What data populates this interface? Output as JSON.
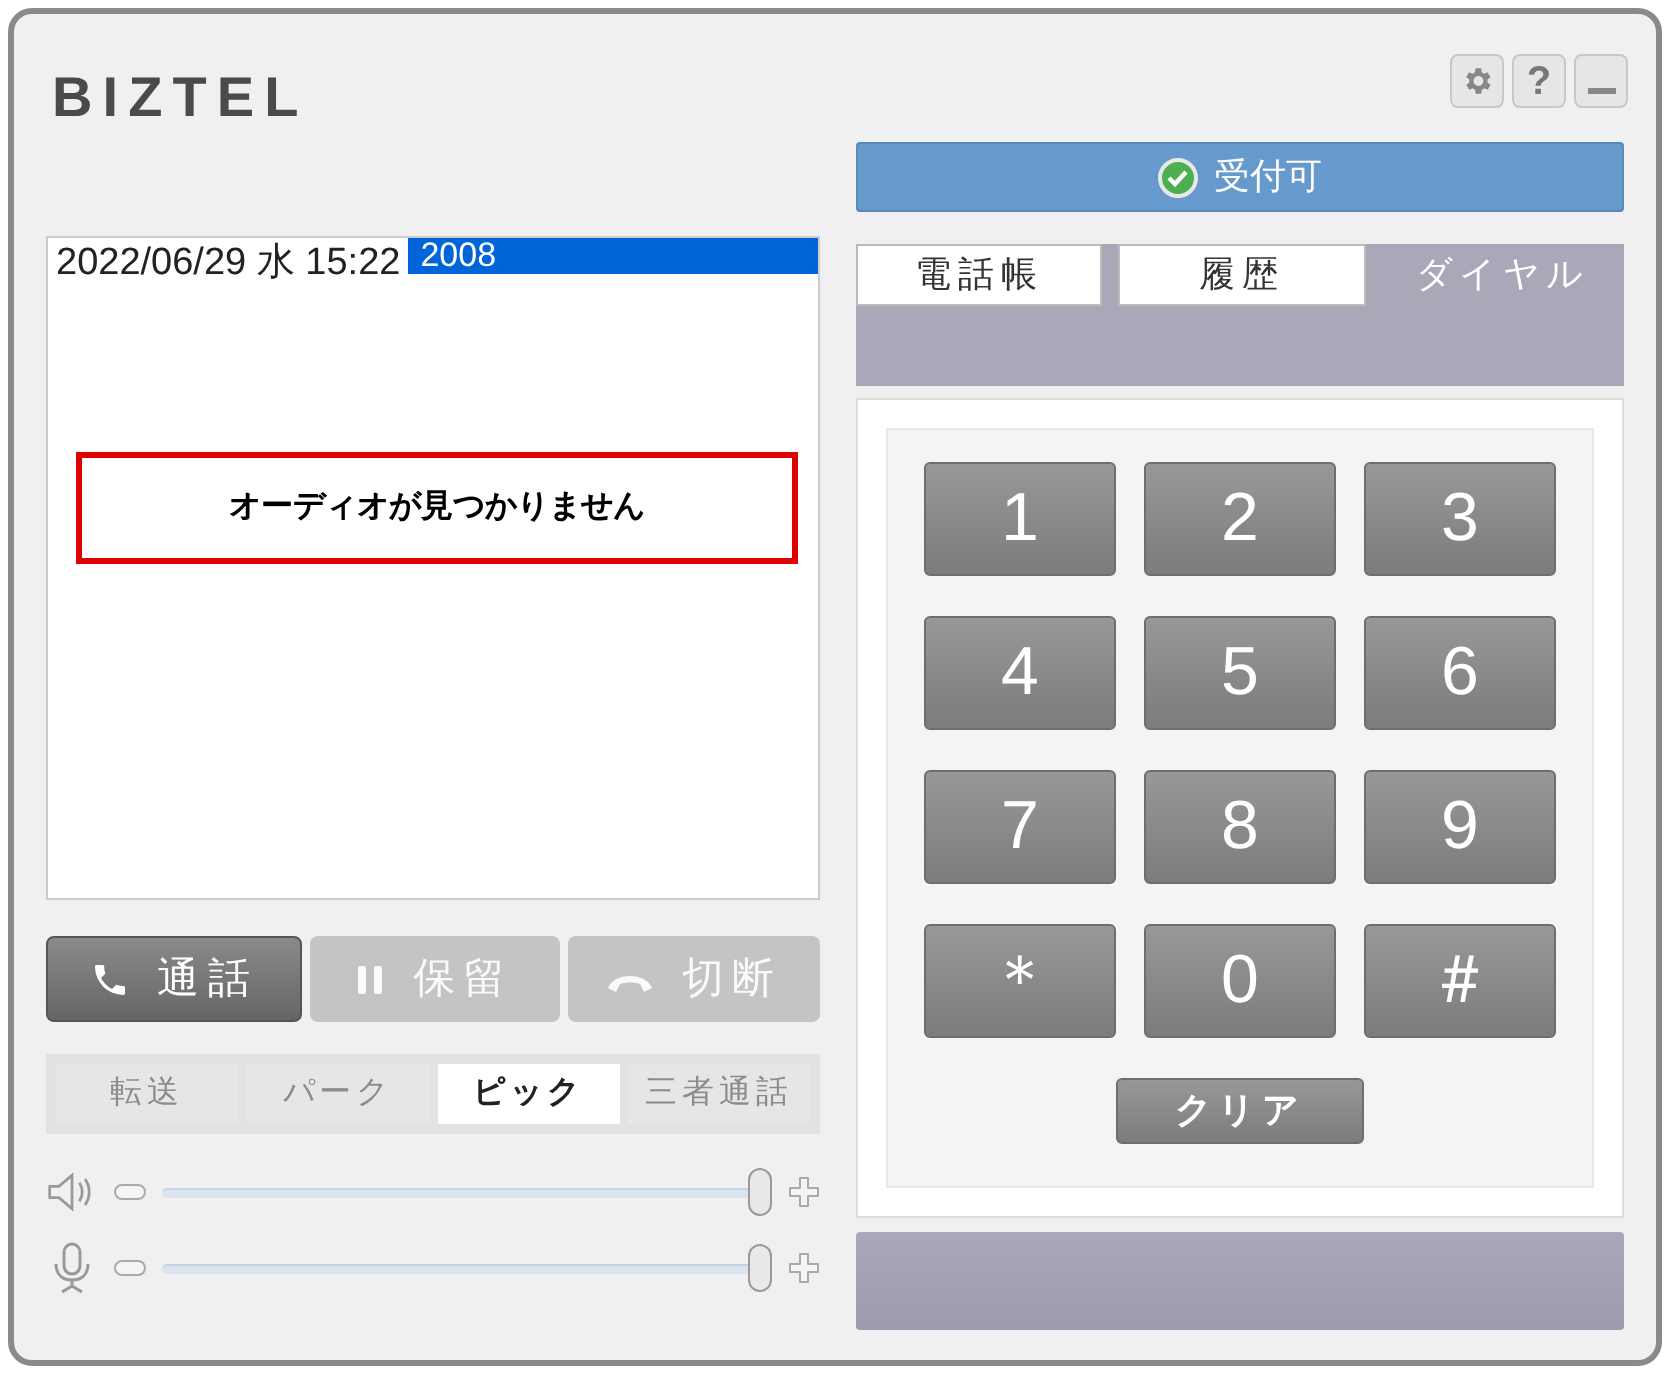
{
  "logo": "BIZTEL",
  "header_buttons": [
    {
      "kind": "settings"
    },
    {
      "kind": "text",
      "label": "?"
    },
    {
      "kind": "minimize"
    }
  ],
  "status": {
    "label": "受付可"
  },
  "log": {
    "timestamp": "2022/06/29 水 15:22",
    "number": "2008",
    "alert": "オーディオが見つかりません"
  },
  "call_buttons": [
    {
      "kind": "call",
      "label": "通話",
      "disabled": false
    },
    {
      "kind": "hold",
      "label": "保留",
      "disabled": true
    },
    {
      "kind": "hangup",
      "label": "切断",
      "disabled": true
    }
  ],
  "sub_tabs": [
    {
      "label": "転送",
      "selected": false
    },
    {
      "label": "パーク",
      "selected": false
    },
    {
      "label": "ピック",
      "selected": true
    },
    {
      "label": "三者通話",
      "selected": false
    }
  ],
  "sliders": [
    {
      "kind": "speaker",
      "level": 1
    },
    {
      "kind": "mic",
      "level": 1
    }
  ],
  "tabs": [
    {
      "label": "電話帳",
      "selected": false
    },
    {
      "label": "履歴",
      "selected": false
    },
    {
      "label": "ダイヤル",
      "selected": true
    }
  ],
  "keypad": [
    "1",
    "2",
    "3",
    "4",
    "5",
    "6",
    "7",
    "8",
    "9",
    "＊",
    "0",
    "＃"
  ],
  "clear_button": "クリア"
}
